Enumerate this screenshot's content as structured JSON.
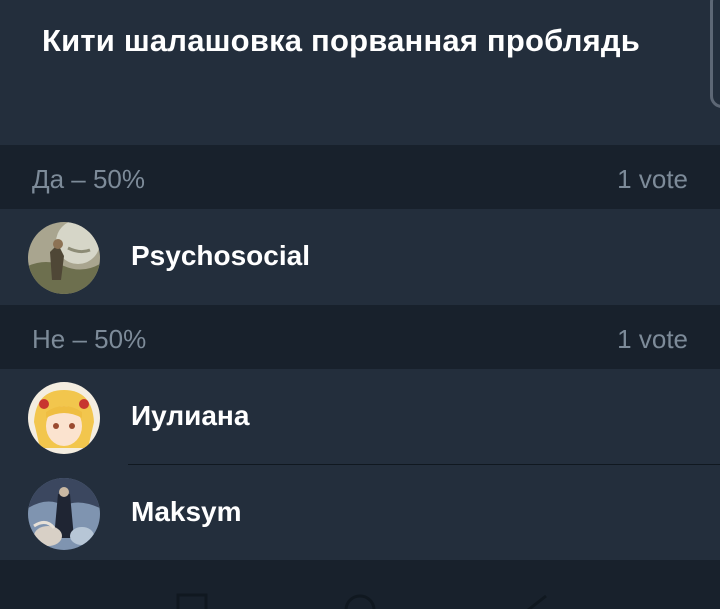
{
  "poll": {
    "title": "Кити шалашовка порванная проблядь"
  },
  "options": [
    {
      "label": "Да – 50%",
      "votes": "1 vote",
      "voters": [
        {
          "name": "Psychosocial",
          "avatar": "painting-avatar"
        }
      ]
    },
    {
      "label": "Не – 50%",
      "votes": "1 vote",
      "voters": [
        {
          "name": "Иулиана",
          "avatar": "anime-girl-avatar"
        },
        {
          "name": "Maksym",
          "avatar": "painting-avatar"
        }
      ]
    }
  ],
  "nav": {
    "icons": [
      "recent-apps-icon",
      "home-icon",
      "back-icon"
    ]
  },
  "colors": {
    "background": "#232e3c",
    "section_header": "#18212c",
    "text_primary": "#ffffff",
    "text_secondary": "#7d8b99"
  }
}
